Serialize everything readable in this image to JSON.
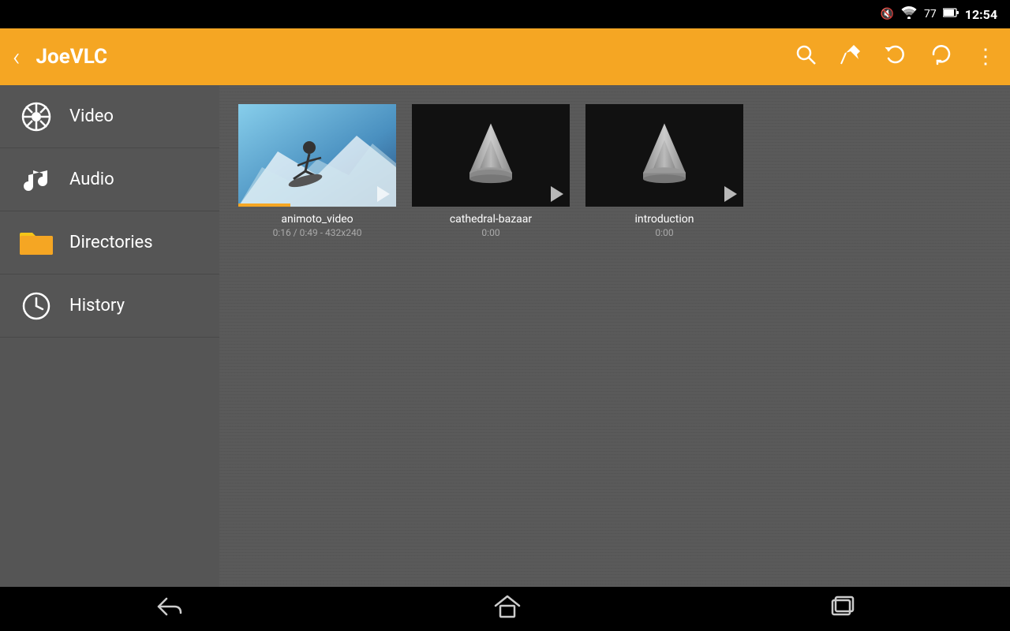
{
  "statusBar": {
    "time": "12:54",
    "batteryLevel": "77"
  },
  "appBar": {
    "title": "JoeVLC",
    "backLabel": "‹",
    "searchTooltip": "Search",
    "pinTooltip": "Pin",
    "undoTooltip": "Undo",
    "refreshTooltip": "Refresh",
    "moreTooltip": "More options"
  },
  "sidebar": {
    "items": [
      {
        "id": "video",
        "label": "Video",
        "icon": "film-icon"
      },
      {
        "id": "audio",
        "label": "Audio",
        "icon": "music-icon"
      },
      {
        "id": "directories",
        "label": "Directories",
        "icon": "folder-icon"
      },
      {
        "id": "history",
        "label": "History",
        "icon": "clock-icon"
      }
    ]
  },
  "content": {
    "items": [
      {
        "id": "animoto_video",
        "title": "animoto_video",
        "meta": "0:16 / 0:49 - 432x240",
        "type": "video-real",
        "hasProgress": true
      },
      {
        "id": "cathedral-bazaar",
        "title": "cathedral-bazaar",
        "meta": "0:00",
        "type": "vlc-cone",
        "hasProgress": false
      },
      {
        "id": "introduction",
        "title": "introduction",
        "meta": "0:00",
        "type": "vlc-cone",
        "hasProgress": false
      }
    ]
  },
  "bottomNav": {
    "backLabel": "⬅",
    "homeLabel": "⌂",
    "recentLabel": "❑"
  }
}
